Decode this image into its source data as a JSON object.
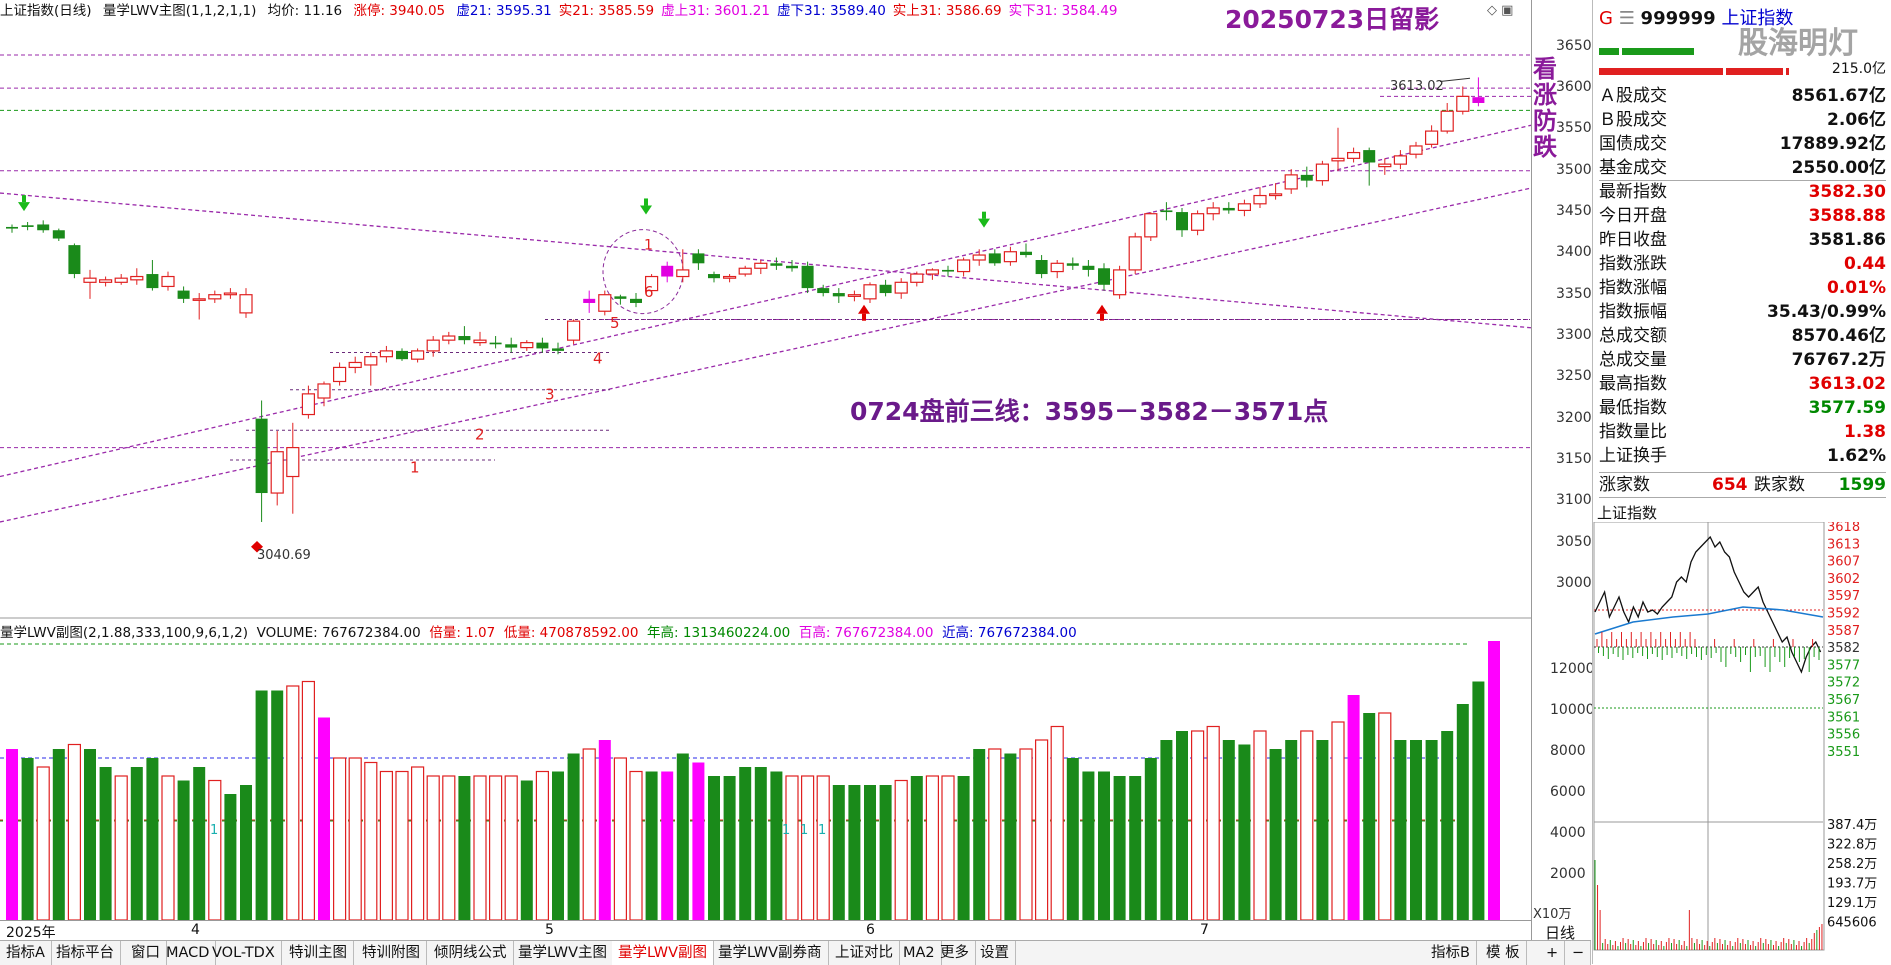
{
  "header": {
    "title": "上证指数(日线)",
    "indicator": "量学LWV主图(1,1,2,1,1)",
    "avg": "均价: 11.16",
    "limit_up": "涨停: 3940.05",
    "items": [
      {
        "text": "虚21: 3595.31",
        "color": "#0000d0"
      },
      {
        "text": "实21: 3585.59",
        "color": "#e00000"
      },
      {
        "text": "虚上31: 3601.21",
        "color": "#e000e0"
      },
      {
        "text": "虚下31: 3589.40",
        "color": "#0000d0"
      },
      {
        "text": "实上31: 3586.69",
        "color": "#e00000"
      },
      {
        "text": "实下31: 3584.49",
        "color": "#e000e0"
      }
    ],
    "date_title": "20250723日留影"
  },
  "annotations": {
    "side_text": [
      "看",
      "涨",
      "防",
      "跌"
    ],
    "lines_text": "0724盘前三线：3595－3582－3571点",
    "high_label": "3613.02",
    "low_label": "3040.69",
    "circle_label_1": "1",
    "circle_label_6": "6",
    "step_labels": [
      "1",
      "2",
      "3",
      "4",
      "5"
    ],
    "vol_markers": [
      "1",
      "1",
      "1",
      "1"
    ]
  },
  "sub_header": {
    "title": "量学LWV副图(2,1.88,333,100,9,6,1,2)",
    "volume": "VOLUME: 767672384.00",
    "ratio": "倍量: 1.07",
    "low_vol": "低量: 470878592.00",
    "year_high": "年高: 1313460224.00",
    "hundred_high": "百高: 767672384.00",
    "near_high": "近高: 767672384.00"
  },
  "price_axis": [
    "3650",
    "3600",
    "3550",
    "3500",
    "3450",
    "3400",
    "3350",
    "3300",
    "3250",
    "3200",
    "3150",
    "3100",
    "3050",
    "3000"
  ],
  "vol_axis": [
    "12000",
    "10000",
    "8000",
    "6000",
    "4000",
    "2000"
  ],
  "vol_unit": "X10万",
  "x_axis": {
    "labels": [
      "2025年",
      "4",
      "5",
      "6",
      "7"
    ],
    "period": "日线"
  },
  "bottom_tabs": [
    "指标A",
    "指标平台",
    "窗口",
    "MACD",
    "VOL-TDX",
    "特训主图",
    "特训附图",
    "倾阴线公式",
    "量学LWV主图",
    "量学LWV副图",
    "量学LWV副券商",
    "上证对比",
    "MA2",
    "更多",
    "设置"
  ],
  "bottom_right": [
    "指标B",
    "模 板",
    "+",
    "−"
  ],
  "right_panel": {
    "code": "999999",
    "name": "上证指数",
    "g_label": "G",
    "watermark": "股海明灯",
    "bar_val": "215.0亿",
    "rows": [
      {
        "label": "Ａ股成交",
        "value": "8561.67亿",
        "color": "#111"
      },
      {
        "label": "Ｂ股成交",
        "value": "2.06亿",
        "color": "#111"
      },
      {
        "label": "国债成交",
        "value": "17889.92亿",
        "color": "#111"
      },
      {
        "label": "基金成交",
        "value": "2550.00亿",
        "color": "#111"
      },
      {
        "label": "最新指数",
        "value": "3582.30",
        "color": "#e00000"
      },
      {
        "label": "今日开盘",
        "value": "3588.88",
        "color": "#e00000"
      },
      {
        "label": "昨日收盘",
        "value": "3581.86",
        "color": "#111"
      },
      {
        "label": "指数涨跌",
        "value": "0.44",
        "color": "#e00000"
      },
      {
        "label": "指数涨幅",
        "value": "0.01%",
        "color": "#e00000"
      },
      {
        "label": "指数振幅",
        "value": "35.43/0.99%",
        "color": "#111"
      },
      {
        "label": "总成交额",
        "value": "8570.46亿",
        "color": "#111"
      },
      {
        "label": "总成交量",
        "value": "76767.2万",
        "color": "#111"
      },
      {
        "label": "最高指数",
        "value": "3613.02",
        "color": "#e00000"
      },
      {
        "label": "最低指数",
        "value": "3577.59",
        "color": "#008800"
      },
      {
        "label": "指数量比",
        "value": "1.38",
        "color": "#e00000"
      },
      {
        "label": "上证换手",
        "value": "1.62%",
        "color": "#111"
      }
    ],
    "breadth": {
      "up_label": "涨家数",
      "up": "654",
      "down_label": "跌家数",
      "down": "1599"
    },
    "intraday_title": "上证指数",
    "intraday_axis": [
      "3618",
      "3613",
      "3607",
      "3602",
      "3597",
      "3592",
      "3587",
      "3582",
      "3577",
      "3572",
      "3567",
      "3561",
      "3556",
      "3551"
    ],
    "intraday_vol_axis": [
      "387.4万",
      "322.8万",
      "258.2万",
      "193.7万",
      "129.1万",
      "645606"
    ]
  },
  "chart_data": {
    "type": "candlestick",
    "ylim": [
      2960,
      3680
    ],
    "candles": [
      [
        3430,
        3435,
        3425,
        3432,
        0
      ],
      [
        3432,
        3438,
        3428,
        3434,
        0
      ],
      [
        3435,
        3440,
        3425,
        3428,
        0
      ],
      [
        3428,
        3430,
        3415,
        3418,
        0
      ],
      [
        3410,
        3412,
        3370,
        3375,
        0
      ],
      [
        3370,
        3380,
        3345,
        3365,
        1
      ],
      [
        3365,
        3372,
        3360,
        3368,
        1
      ],
      [
        3365,
        3375,
        3362,
        3370,
        1
      ],
      [
        3368,
        3382,
        3362,
        3372,
        1
      ],
      [
        3375,
        3392,
        3355,
        3358,
        0
      ],
      [
        3360,
        3378,
        3355,
        3372,
        1
      ],
      [
        3355,
        3360,
        3340,
        3345,
        0
      ],
      [
        3345,
        3352,
        3320,
        3345,
        1
      ],
      [
        3345,
        3355,
        3340,
        3350,
        1
      ],
      [
        3350,
        3358,
        3345,
        3352,
        1
      ],
      [
        3350,
        3358,
        3322,
        3328,
        1
      ],
      [
        3200,
        3222,
        3075,
        3110,
        0
      ],
      [
        3110,
        3185,
        3095,
        3160,
        1
      ],
      [
        3130,
        3195,
        3085,
        3165,
        1
      ],
      [
        3205,
        3240,
        3200,
        3230,
        1
      ],
      [
        3225,
        3245,
        3215,
        3242,
        1
      ],
      [
        3245,
        3268,
        3240,
        3262,
        1
      ],
      [
        3262,
        3275,
        3255,
        3268,
        1
      ],
      [
        3265,
        3280,
        3240,
        3275,
        1
      ],
      [
        3275,
        3288,
        3268,
        3282,
        1
      ],
      [
        3282,
        3285,
        3270,
        3272,
        0
      ],
      [
        3272,
        3285,
        3268,
        3282,
        1
      ],
      [
        3282,
        3300,
        3275,
        3295,
        1
      ],
      [
        3295,
        3305,
        3290,
        3300,
        1
      ],
      [
        3300,
        3312,
        3290,
        3295,
        0
      ],
      [
        3295,
        3305,
        3288,
        3292,
        1
      ],
      [
        3292,
        3300,
        3285,
        3290,
        0
      ],
      [
        3290,
        3298,
        3280,
        3286,
        0
      ],
      [
        3286,
        3295,
        3282,
        3292,
        1
      ],
      [
        3292,
        3298,
        3280,
        3285,
        0
      ],
      [
        3285,
        3292,
        3278,
        3282,
        0
      ],
      [
        3295,
        3320,
        3290,
        3318,
        1
      ],
      [
        3340,
        3355,
        3328,
        3345,
        2
      ],
      [
        3330,
        3355,
        3325,
        3350,
        1
      ],
      [
        3345,
        3350,
        3338,
        3348,
        0
      ],
      [
        3345,
        3352,
        3335,
        3340,
        0
      ],
      [
        3355,
        3375,
        3352,
        3372,
        1
      ],
      [
        3372,
        3390,
        3365,
        3385,
        2
      ],
      [
        3380,
        3405,
        3365,
        3372,
        1
      ],
      [
        3400,
        3405,
        3380,
        3388,
        0
      ],
      [
        3375,
        3378,
        3365,
        3370,
        0
      ],
      [
        3370,
        3375,
        3365,
        3372,
        1
      ],
      [
        3375,
        3385,
        3372,
        3382,
        1
      ],
      [
        3382,
        3392,
        3375,
        3388,
        1
      ],
      [
        3388,
        3395,
        3380,
        3385,
        0
      ],
      [
        3385,
        3392,
        3378,
        3382,
        0
      ],
      [
        3385,
        3390,
        3352,
        3358,
        0
      ],
      [
        3358,
        3362,
        3348,
        3352,
        0
      ],
      [
        3352,
        3358,
        3340,
        3348,
        0
      ],
      [
        3348,
        3355,
        3342,
        3350,
        1
      ],
      [
        3345,
        3365,
        3340,
        3362,
        1
      ],
      [
        3362,
        3368,
        3348,
        3352,
        0
      ],
      [
        3352,
        3370,
        3345,
        3365,
        1
      ],
      [
        3365,
        3378,
        3360,
        3375,
        1
      ],
      [
        3375,
        3382,
        3368,
        3380,
        1
      ],
      [
        3380,
        3385,
        3372,
        3378,
        0
      ],
      [
        3378,
        3395,
        3372,
        3392,
        1
      ],
      [
        3392,
        3405,
        3385,
        3398,
        1
      ],
      [
        3400,
        3405,
        3385,
        3388,
        0
      ],
      [
        3390,
        3408,
        3385,
        3402,
        1
      ],
      [
        3402,
        3412,
        3395,
        3398,
        0
      ],
      [
        3392,
        3398,
        3370,
        3375,
        0
      ],
      [
        3378,
        3392,
        3370,
        3388,
        1
      ],
      [
        3388,
        3395,
        3380,
        3385,
        0
      ],
      [
        3385,
        3392,
        3372,
        3380,
        0
      ],
      [
        3382,
        3388,
        3355,
        3362,
        0
      ],
      [
        3350,
        3385,
        3345,
        3380,
        1
      ],
      [
        3380,
        3425,
        3375,
        3420,
        1
      ],
      [
        3420,
        3450,
        3415,
        3448,
        1
      ],
      [
        3450,
        3462,
        3440,
        3452,
        0
      ],
      [
        3450,
        3455,
        3420,
        3428,
        0
      ],
      [
        3428,
        3452,
        3422,
        3448,
        1
      ],
      [
        3448,
        3462,
        3440,
        3455,
        1
      ],
      [
        3455,
        3462,
        3448,
        3452,
        0
      ],
      [
        3452,
        3465,
        3445,
        3460,
        1
      ],
      [
        3460,
        3480,
        3455,
        3470,
        1
      ],
      [
        3470,
        3485,
        3465,
        3472,
        1
      ],
      [
        3478,
        3502,
        3472,
        3495,
        1
      ],
      [
        3495,
        3505,
        3480,
        3488,
        0
      ],
      [
        3488,
        3512,
        3482,
        3508,
        1
      ],
      [
        3512,
        3552,
        3500,
        3515,
        1
      ],
      [
        3515,
        3528,
        3510,
        3522,
        1
      ],
      [
        3525,
        3528,
        3482,
        3510,
        0
      ],
      [
        3505,
        3515,
        3495,
        3508,
        1
      ],
      [
        3508,
        3525,
        3502,
        3518,
        1
      ],
      [
        3520,
        3535,
        3515,
        3530,
        1
      ],
      [
        3532,
        3555,
        3528,
        3548,
        1
      ],
      [
        3548,
        3582,
        3545,
        3572,
        1
      ],
      [
        3572,
        3602,
        3568,
        3590,
        1
      ],
      [
        3589,
        3613,
        3578,
        3582,
        2
      ]
    ],
    "volume": [
      [
        0.38,
        2
      ],
      [
        0.36,
        0
      ],
      [
        0.34,
        1
      ],
      [
        0.38,
        0
      ],
      [
        0.39,
        1
      ],
      [
        0.38,
        0
      ],
      [
        0.34,
        0
      ],
      [
        0.32,
        1
      ],
      [
        0.34,
        0
      ],
      [
        0.36,
        0
      ],
      [
        0.32,
        1
      ],
      [
        0.31,
        0
      ],
      [
        0.34,
        0
      ],
      [
        0.31,
        1
      ],
      [
        0.28,
        0
      ],
      [
        0.3,
        0
      ],
      [
        0.51,
        0
      ],
      [
        0.51,
        0
      ],
      [
        0.52,
        1
      ],
      [
        0.53,
        1
      ],
      [
        0.45,
        2
      ],
      [
        0.36,
        1
      ],
      [
        0.36,
        1
      ],
      [
        0.35,
        1
      ],
      [
        0.33,
        1
      ],
      [
        0.33,
        1
      ],
      [
        0.34,
        1
      ],
      [
        0.32,
        1
      ],
      [
        0.32,
        1
      ],
      [
        0.32,
        0
      ],
      [
        0.32,
        1
      ],
      [
        0.32,
        1
      ],
      [
        0.32,
        1
      ],
      [
        0.31,
        0
      ],
      [
        0.33,
        1
      ],
      [
        0.33,
        0
      ],
      [
        0.37,
        0
      ],
      [
        0.38,
        1
      ],
      [
        0.4,
        2
      ],
      [
        0.36,
        1
      ],
      [
        0.33,
        1
      ],
      [
        0.33,
        0
      ],
      [
        0.33,
        2
      ],
      [
        0.37,
        0
      ],
      [
        0.35,
        2
      ],
      [
        0.32,
        0
      ],
      [
        0.32,
        0
      ],
      [
        0.34,
        0
      ],
      [
        0.34,
        0
      ],
      [
        0.33,
        0
      ],
      [
        0.32,
        1
      ],
      [
        0.32,
        1
      ],
      [
        0.32,
        1
      ],
      [
        0.3,
        0
      ],
      [
        0.3,
        0
      ],
      [
        0.3,
        0
      ],
      [
        0.3,
        0
      ],
      [
        0.31,
        1
      ],
      [
        0.32,
        0
      ],
      [
        0.32,
        1
      ],
      [
        0.32,
        1
      ],
      [
        0.32,
        0
      ],
      [
        0.38,
        0
      ],
      [
        0.38,
        1
      ],
      [
        0.37,
        0
      ],
      [
        0.38,
        1
      ],
      [
        0.4,
        1
      ],
      [
        0.43,
        1
      ],
      [
        0.36,
        0
      ],
      [
        0.33,
        0
      ],
      [
        0.33,
        0
      ],
      [
        0.32,
        0
      ],
      [
        0.32,
        0
      ],
      [
        0.36,
        0
      ],
      [
        0.4,
        0
      ],
      [
        0.42,
        0
      ],
      [
        0.42,
        1
      ],
      [
        0.43,
        1
      ],
      [
        0.4,
        0
      ],
      [
        0.39,
        0
      ],
      [
        0.42,
        1
      ],
      [
        0.38,
        0
      ],
      [
        0.4,
        0
      ],
      [
        0.42,
        1
      ],
      [
        0.4,
        0
      ],
      [
        0.44,
        1
      ],
      [
        0.5,
        2
      ],
      [
        0.46,
        0
      ],
      [
        0.46,
        1
      ],
      [
        0.4,
        0
      ],
      [
        0.4,
        0
      ],
      [
        0.4,
        0
      ],
      [
        0.42,
        0
      ],
      [
        0.48,
        0
      ],
      [
        0.53,
        0
      ],
      [
        0.62,
        2
      ]
    ]
  }
}
